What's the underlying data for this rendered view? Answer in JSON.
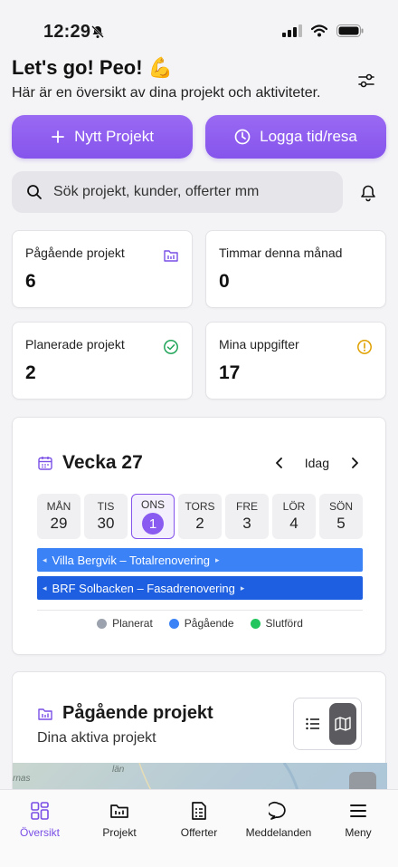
{
  "status": {
    "time": "12:29"
  },
  "greeting": {
    "title": "Let's go! Peo! 💪",
    "subtitle": "Här är en översikt av dina projekt och aktiviteter."
  },
  "actions": {
    "new_project": "Nytt Projekt",
    "log_time": "Logga tid/resa"
  },
  "search": {
    "placeholder": "Sök projekt, kunder, offerter mm"
  },
  "stats": [
    {
      "label": "Pågående projekt",
      "value": "6",
      "icon": "folder-chart-icon",
      "color": "#7a4fe6"
    },
    {
      "label": "Timmar denna månad",
      "value": "0"
    },
    {
      "label": "Planerade projekt",
      "value": "2",
      "icon": "check-circle-icon",
      "color": "#22a55a"
    },
    {
      "label": "Mina uppgifter",
      "value": "17",
      "icon": "alert-circle-icon",
      "color": "#e0a100"
    }
  ],
  "week": {
    "title": "Vecka 27",
    "today": "Idag",
    "days": [
      {
        "name": "MÅN",
        "date": "29"
      },
      {
        "name": "TIS",
        "date": "30"
      },
      {
        "name": "ONS",
        "date": "1"
      },
      {
        "name": "TORS",
        "date": "2"
      },
      {
        "name": "FRE",
        "date": "3"
      },
      {
        "name": "LÖR",
        "date": "4"
      },
      {
        "name": "SÖN",
        "date": "5"
      }
    ],
    "bars": [
      "Villa Bergvik – Totalrenovering",
      "BRF Solbacken – Fasadrenovering"
    ],
    "legend": [
      {
        "label": "Planerat",
        "color": "#9ca3af"
      },
      {
        "label": "Pågående",
        "color": "#3b82f6"
      },
      {
        "label": "Slutförd",
        "color": "#22c55e"
      }
    ]
  },
  "projects": {
    "title": "Pågående projekt",
    "subtitle": "Dina aktiva projekt",
    "map_labels": [
      "län",
      "rnas"
    ],
    "map_zoom": "3"
  },
  "tabs": [
    {
      "label": "Översikt",
      "icon": "grid-icon",
      "active": true
    },
    {
      "label": "Projekt",
      "icon": "folder-chart-icon"
    },
    {
      "label": "Offerter",
      "icon": "document-icon"
    },
    {
      "label": "Meddelanden",
      "icon": "chat-bubble-icon"
    },
    {
      "label": "Meny",
      "icon": "hamburger-icon"
    }
  ],
  "colors": {
    "accent": "#8554ec",
    "bar_blue": "#3b82f6",
    "bar_dark_blue": "#1d5fe0"
  }
}
